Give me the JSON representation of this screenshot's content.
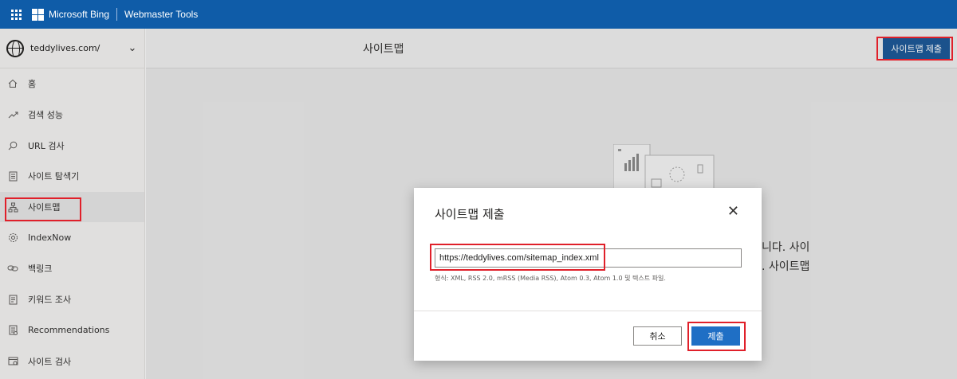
{
  "topbar": {
    "brand": "Microsoft Bing",
    "product": "Webmaster Tools"
  },
  "sidebar": {
    "site": "teddylives.com/",
    "items": [
      {
        "label": "홈",
        "icon": "home-icon"
      },
      {
        "label": "검색 성능",
        "icon": "trend-icon"
      },
      {
        "label": "URL 검사",
        "icon": "search-icon"
      },
      {
        "label": "사이트 탐색기",
        "icon": "document-icon"
      },
      {
        "label": "사이트맵",
        "icon": "sitemap-icon"
      },
      {
        "label": "IndexNow",
        "icon": "gear-icon"
      },
      {
        "label": "백링크",
        "icon": "link-icon"
      },
      {
        "label": "키워드 조사",
        "icon": "document-icon"
      },
      {
        "label": "Recommendations",
        "icon": "list-icon"
      },
      {
        "label": "사이트 검사",
        "icon": "scan-icon"
      }
    ]
  },
  "main": {
    "title": "사이트맵",
    "submit_button": "사이트맵 제출",
    "bg_text_1": "니다. 사이",
    "bg_text_2": ". 사이트맵"
  },
  "dialog": {
    "title": "사이트맵 제출",
    "url_value": "https://teddylives.com/sitemap_index.xml",
    "help": "형식: XML, RSS 2.0, mRSS (Media RSS), Atom 0.3, Atom 1.0 및 텍스트 파일.",
    "cancel": "취소",
    "submit": "제출"
  },
  "colors": {
    "topbar": "#0f5ca8",
    "primary_button": "#1f6fc5",
    "highlight": "#e0202a"
  }
}
